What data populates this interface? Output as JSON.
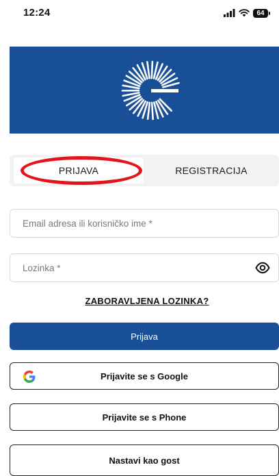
{
  "status_bar": {
    "time": "12:24",
    "battery": "64",
    "icons": [
      "signal-icon",
      "wifi-icon",
      "battery-icon"
    ]
  },
  "brand": {
    "logo": "g-sunburst-logo",
    "banner_color": "#184f96"
  },
  "tabs": [
    {
      "label": "PRIJAVA",
      "active": true
    },
    {
      "label": "REGISTRACIJA",
      "active": false
    }
  ],
  "form": {
    "email_placeholder": "Email adresa ili korisničko ime *",
    "email_value": "",
    "password_placeholder": "Lozinka *",
    "password_value": "",
    "forgot_label": "ZABORAVLJENA LOZINKA?"
  },
  "buttons": {
    "login_label": "Prijava",
    "google_label": "Prijavite se s Google",
    "phone_label": "Prijavite se s Phone",
    "guest_label": "Nastavi kao gost"
  },
  "colors": {
    "primary": "#184f96",
    "annotation": "#e3141c"
  }
}
